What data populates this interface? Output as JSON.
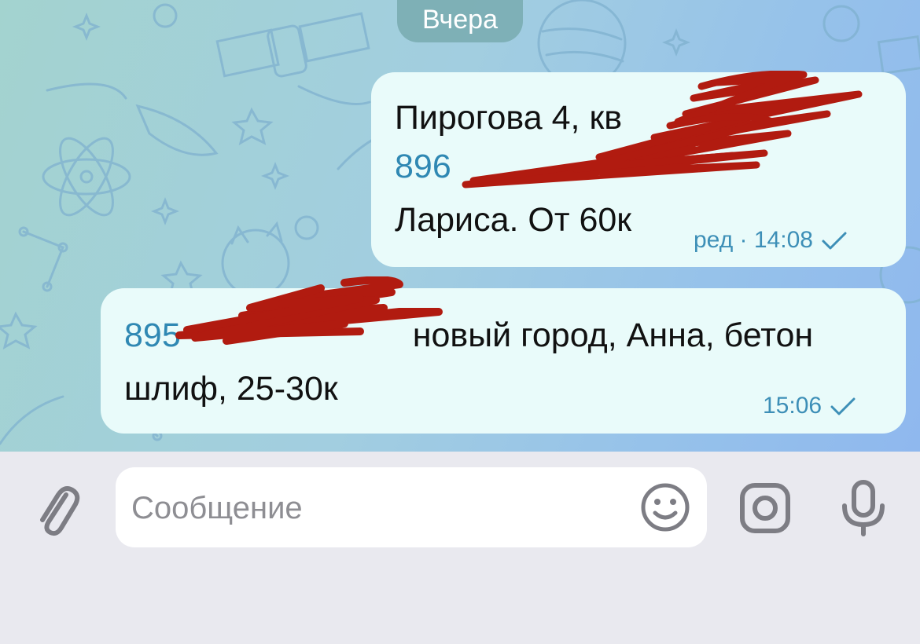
{
  "date_separator": "Вчера",
  "messages": [
    {
      "line1": "Пирогова 4, кв",
      "line2_phone": "896",
      "line3": "Лариса. От 60к",
      "meta_label": "ред · 14:08",
      "status": "sent-check"
    },
    {
      "line1_phone": "895",
      "line1_text": "новый город, Анна, бетон",
      "line2": "шлиф, 25-30к",
      "meta_label": "15:06",
      "status": "sent-check"
    }
  ],
  "composer": {
    "placeholder": "Сообщение",
    "icons": [
      "paperclip-icon",
      "emoji-icon",
      "camera-icon",
      "microphone-icon"
    ]
  },
  "colors": {
    "bubble_bg": "#e9fbfa",
    "phone_link": "#2f88b3",
    "meta_text": "#3d8fb7",
    "redaction": "#b11b10"
  }
}
